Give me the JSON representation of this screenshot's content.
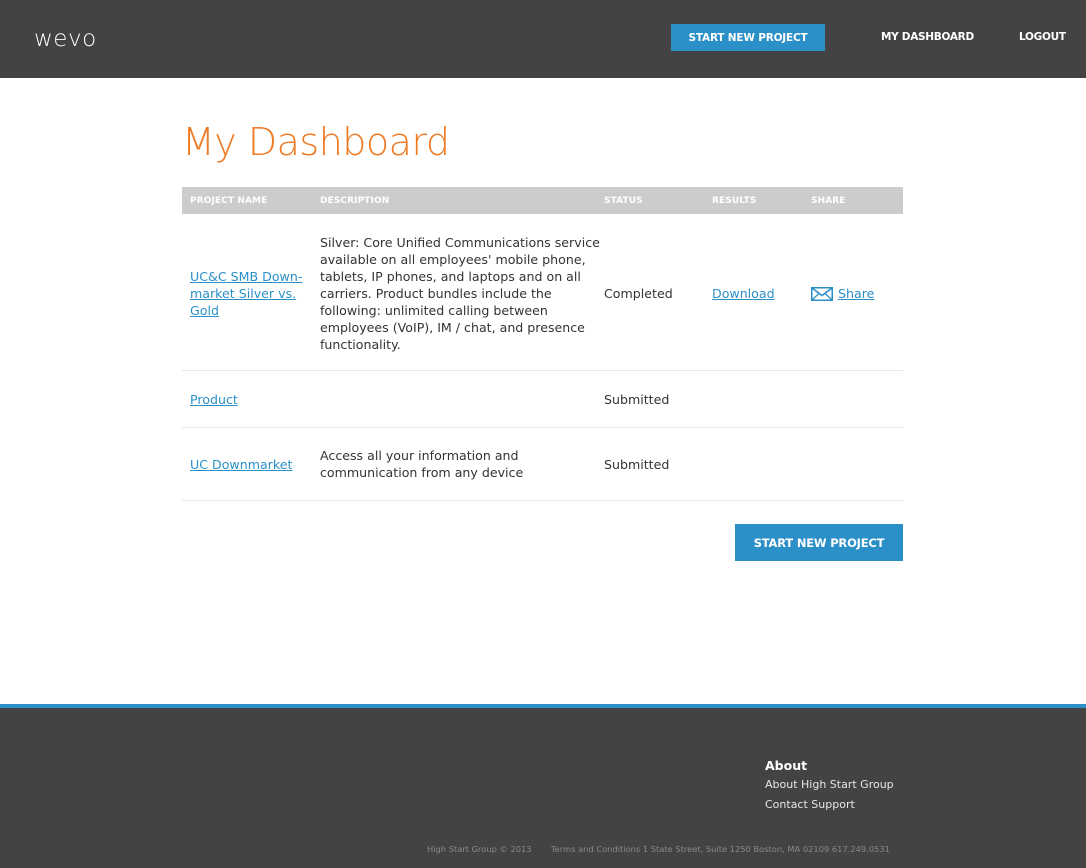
{
  "header": {
    "logo": "wevo",
    "start_button": "START NEW PROJECT",
    "dashboard_link": "MY DASHBOARD",
    "logout_link": "LOGOUT"
  },
  "page": {
    "title": "My Dashboard"
  },
  "table": {
    "columns": [
      "PROJECT NAME",
      "DESCRIPTION",
      "STATUS",
      "RESULTS",
      "SHARE"
    ],
    "rows": [
      {
        "name_lines": [
          "UC&C SMB Down-",
          "market Silver vs.",
          "Gold"
        ],
        "description_lines": [
          "Silver: Core Unified Communications service",
          "available on all employees' mobile phone,",
          "tablets, IP phones, and laptops and on all",
          "carriers. Product bundles include the",
          "following: unlimited calling between",
          "employees (VoIP), IM / chat, and presence",
          "functionality."
        ],
        "status": "Completed",
        "results": "Download",
        "share": "Share"
      },
      {
        "name_lines": [
          "Product"
        ],
        "description_lines": [],
        "status": "Submitted",
        "results": "",
        "share": ""
      },
      {
        "name_lines": [
          "UC Downmarket"
        ],
        "description_lines": [
          "Access all your information and",
          "communication from any device"
        ],
        "status": "Submitted",
        "results": "",
        "share": ""
      }
    ]
  },
  "main_button": "START NEW PROJECT",
  "footer": {
    "about_heading": "About",
    "about_links": [
      "About High Start Group",
      "Contact Support"
    ],
    "copyright": "High Start Group © 2013",
    "legal": "Terms and Conditions 1 State Street, Suite 1250 Boston, MA 02109 617.249.0531"
  },
  "colors": {
    "header_bg": "#434343",
    "accent_blue": "#2b8fc8",
    "title_orange": "#ee7a23",
    "table_header_bg": "#cccccc"
  },
  "icons": {
    "share": "envelope-icon"
  }
}
